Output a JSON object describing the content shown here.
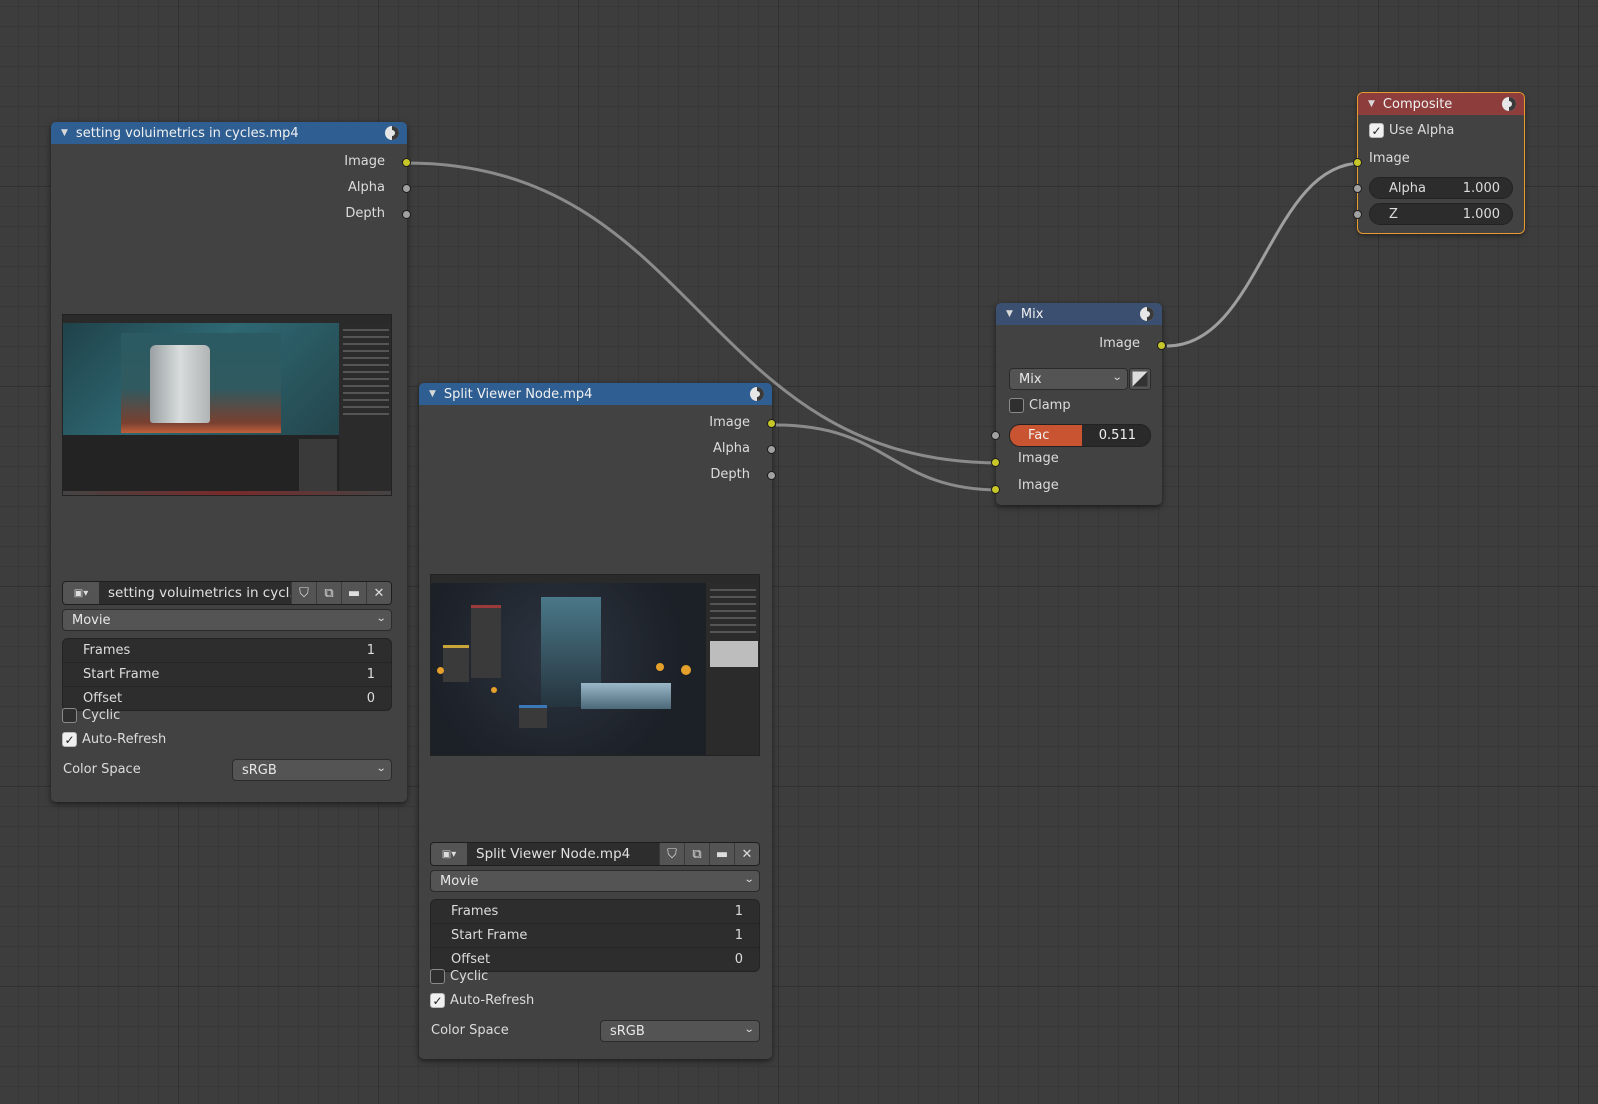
{
  "nodes": {
    "movie1": {
      "title": "setting voluimetrics in cycles.mp4",
      "outputs": [
        "Image",
        "Alpha",
        "Depth"
      ],
      "filename": "setting voluimetrics in cycl...",
      "source": "Movie",
      "frames_label": "Frames",
      "frames": "1",
      "start_label": "Start Frame",
      "start": "1",
      "offset_label": "Offset",
      "offset": "0",
      "cyclic": "Cyclic",
      "autorefresh": "Auto-Refresh",
      "colorspace_label": "Color Space",
      "colorspace": "sRGB"
    },
    "movie2": {
      "title": "Split Viewer Node.mp4",
      "outputs": [
        "Image",
        "Alpha",
        "Depth"
      ],
      "filename": "Split Viewer Node.mp4",
      "source": "Movie",
      "frames_label": "Frames",
      "frames": "1",
      "start_label": "Start Frame",
      "start": "1",
      "offset_label": "Offset",
      "offset": "0",
      "cyclic": "Cyclic",
      "autorefresh": "Auto-Refresh",
      "colorspace_label": "Color Space",
      "colorspace": "sRGB"
    },
    "mix": {
      "title": "Mix",
      "output": "Image",
      "blend": "Mix",
      "clamp": "Clamp",
      "fac_label": "Fac",
      "fac": "0.511",
      "fac_fraction": 0.511,
      "input1": "Image",
      "input2": "Image"
    },
    "composite": {
      "title": "Composite",
      "use_alpha": "Use Alpha",
      "input_image": "Image",
      "alpha_label": "Alpha",
      "alpha": "1.000",
      "z_label": "Z",
      "z": "1.000"
    }
  },
  "colors": {
    "header_input": "#2f5f92",
    "header_mix": "#3b4f70",
    "header_output": "#8e3d3d",
    "socket_color": "#c7c729",
    "socket_float": "#a1a1a1",
    "selection": "#e79a2d",
    "fac_fill": "#c85432"
  },
  "icons": [
    "collapse-arrow-icon",
    "globe-preview-icon",
    "image-browse-icon",
    "fake-user-shield-icon",
    "duplicate-icon",
    "folder-icon",
    "close-icon",
    "chevron-down-icon",
    "checkmark-icon",
    "alpha-toggle-icon"
  ]
}
